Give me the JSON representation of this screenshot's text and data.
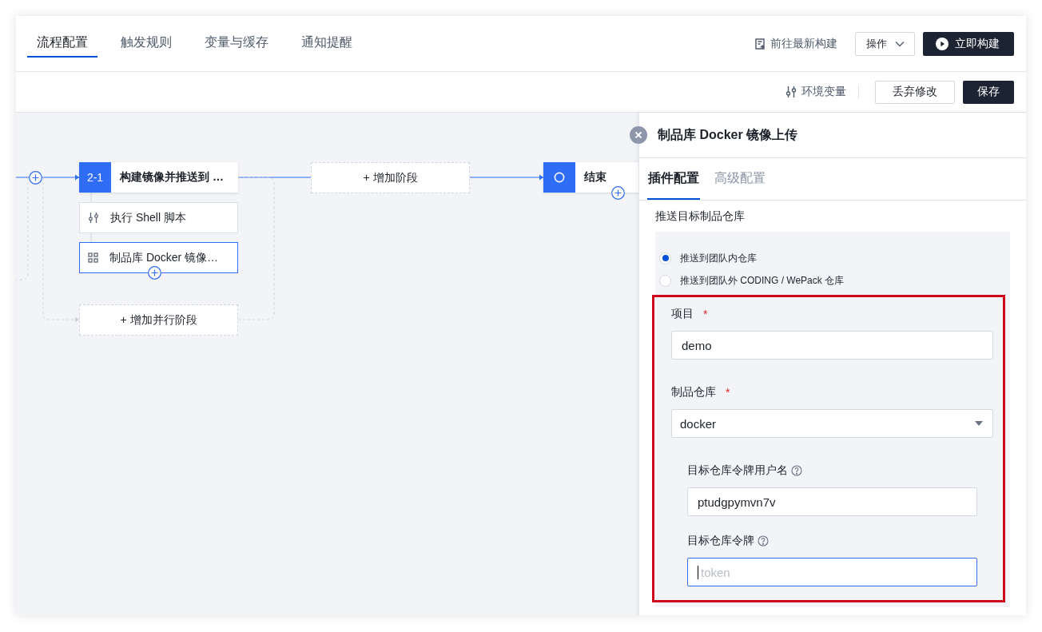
{
  "tabs": [
    {
      "label": "流程配置",
      "selected": true
    },
    {
      "label": "触发规则",
      "selected": false
    },
    {
      "label": "变量与缓存",
      "selected": false
    },
    {
      "label": "通知提醒",
      "selected": false
    }
  ],
  "header_actions": {
    "latest_build_link": "前往最新构建",
    "actions_menu": "操作",
    "build_now_button": "立即构建"
  },
  "toolbar": {
    "env_vars_button": "环境变量",
    "discard_button": "丢弃修改",
    "save_button": "保存"
  },
  "pipeline": {
    "stage": {
      "badge": "2-1",
      "title": "构建镜像并推送到 …",
      "jobs": [
        {
          "label": "执行 Shell 脚本",
          "kind": "shell",
          "selected": false
        },
        {
          "label": "制品库 Docker 镜像…",
          "kind": "plugin",
          "selected": true
        }
      ]
    },
    "add_stage": "+ 增加阶段",
    "add_parallel_stage": "+ 增加并行阶段",
    "end_node": {
      "title": "结束"
    }
  },
  "panel": {
    "title": "制品库 Docker 镜像上传",
    "tabs": [
      {
        "label": "插件配置",
        "selected": true
      },
      {
        "label": "高级配置",
        "selected": false
      }
    ],
    "section_label": "推送目标制品仓库",
    "radios": [
      {
        "label": "推送到团队内仓库",
        "selected": true
      },
      {
        "label": "推送到团队外 CODING / WePack 仓库",
        "selected": false
      }
    ],
    "fields_highlighted": true,
    "fields": [
      {
        "kind": "text",
        "label": "项目",
        "required_mark": "*",
        "value": "demo"
      },
      {
        "kind": "select",
        "label": "制品仓库",
        "required_mark": "*",
        "value": "docker",
        "children": [
          {
            "kind": "text",
            "label": "目标仓库令牌用户名",
            "help": true,
            "value": "ptudgpymvn7v"
          },
          {
            "kind": "text",
            "label": "目标仓库令牌",
            "help": true,
            "placeholder": "token",
            "focused": true
          }
        ]
      }
    ]
  }
}
